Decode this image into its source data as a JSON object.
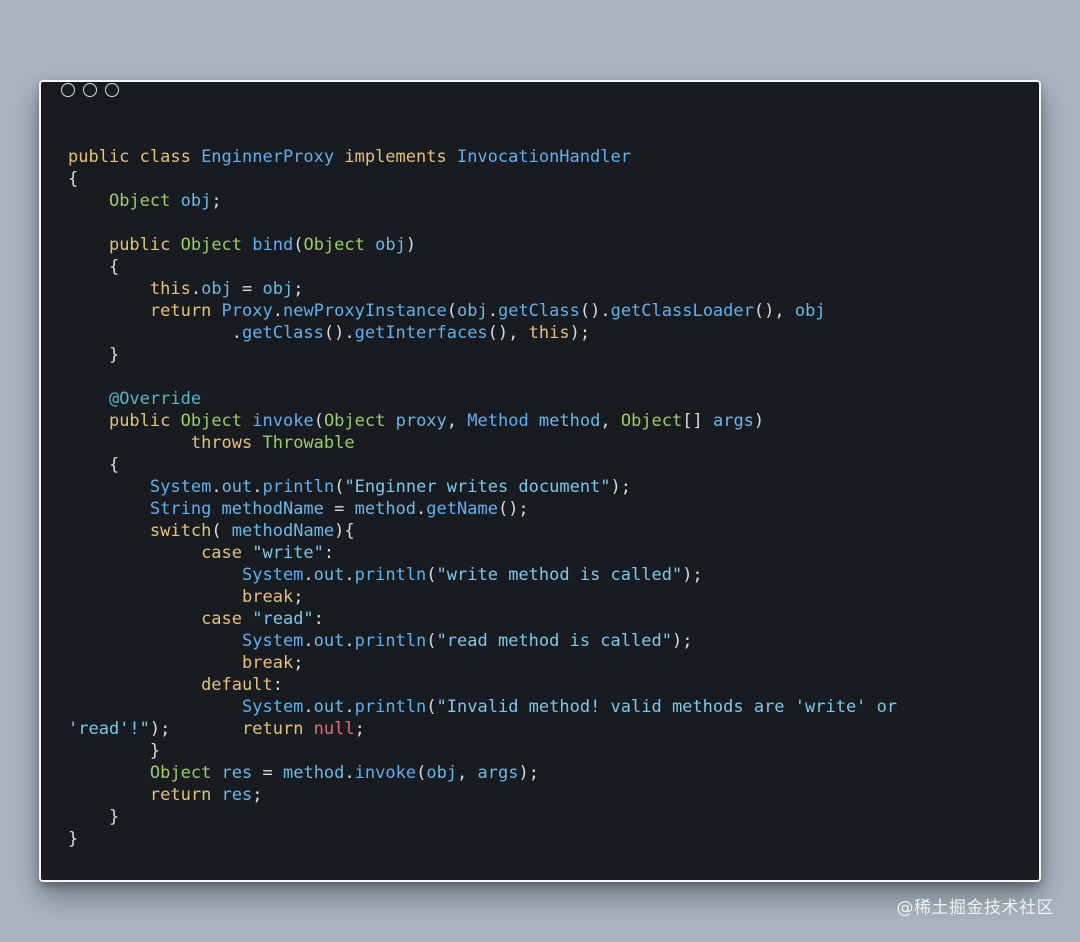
{
  "window": {
    "controls": [
      "window-dot",
      "window-dot",
      "window-dot"
    ]
  },
  "code": {
    "language": "java",
    "lines": [
      [
        [
          "kw",
          "public class "
        ],
        [
          "fn",
          "EnginnerProxy "
        ],
        [
          "kw",
          "implements "
        ],
        [
          "fn",
          "InvocationHandler"
        ]
      ],
      [
        [
          "pu",
          "{"
        ]
      ],
      [
        [
          "pu",
          "    "
        ],
        [
          "ty",
          "Object "
        ],
        [
          "id",
          "obj"
        ],
        [
          "pu",
          ";"
        ]
      ],
      [],
      [
        [
          "pu",
          "    "
        ],
        [
          "kw",
          "public "
        ],
        [
          "ty",
          "Object "
        ],
        [
          "fn",
          "bind"
        ],
        [
          "pu",
          "("
        ],
        [
          "ty",
          "Object "
        ],
        [
          "id",
          "obj"
        ],
        [
          "pu",
          ")"
        ]
      ],
      [
        [
          "pu",
          "    {"
        ]
      ],
      [
        [
          "pu",
          "        "
        ],
        [
          "kw",
          "this"
        ],
        [
          "pu",
          "."
        ],
        [
          "id",
          "obj"
        ],
        [
          "pu",
          " = "
        ],
        [
          "id",
          "obj"
        ],
        [
          "pu",
          ";"
        ]
      ],
      [
        [
          "pu",
          "        "
        ],
        [
          "kw",
          "return "
        ],
        [
          "fn",
          "Proxy"
        ],
        [
          "pu",
          "."
        ],
        [
          "fn",
          "newProxyInstance"
        ],
        [
          "pu",
          "("
        ],
        [
          "id",
          "obj"
        ],
        [
          "pu",
          "."
        ],
        [
          "fn",
          "getClass"
        ],
        [
          "pu",
          "()."
        ],
        [
          "fn",
          "getClassLoader"
        ],
        [
          "pu",
          "(), "
        ],
        [
          "id",
          "obj"
        ]
      ],
      [
        [
          "pu",
          "                ."
        ],
        [
          "fn",
          "getClass"
        ],
        [
          "pu",
          "()."
        ],
        [
          "fn",
          "getInterfaces"
        ],
        [
          "pu",
          "(), "
        ],
        [
          "kw",
          "this"
        ],
        [
          "pu",
          ");"
        ]
      ],
      [
        [
          "pu",
          "    }"
        ]
      ],
      [],
      [
        [
          "pu",
          "    "
        ],
        [
          "an",
          "@Override"
        ]
      ],
      [
        [
          "pu",
          "    "
        ],
        [
          "kw",
          "public "
        ],
        [
          "ty",
          "Object "
        ],
        [
          "fn",
          "invoke"
        ],
        [
          "pu",
          "("
        ],
        [
          "ty",
          "Object "
        ],
        [
          "id",
          "proxy"
        ],
        [
          "pu",
          ", "
        ],
        [
          "fn",
          "Method "
        ],
        [
          "id",
          "method"
        ],
        [
          "pu",
          ", "
        ],
        [
          "ty",
          "Object"
        ],
        [
          "pu",
          "[] "
        ],
        [
          "id",
          "args"
        ],
        [
          "pu",
          ")"
        ]
      ],
      [
        [
          "pu",
          "            "
        ],
        [
          "kw",
          "throws "
        ],
        [
          "ty",
          "Throwable"
        ]
      ],
      [
        [
          "pu",
          "    {"
        ]
      ],
      [
        [
          "pu",
          "        "
        ],
        [
          "fn",
          "System"
        ],
        [
          "pu",
          "."
        ],
        [
          "id",
          "out"
        ],
        [
          "pu",
          "."
        ],
        [
          "fn",
          "println"
        ],
        [
          "pu",
          "("
        ],
        [
          "st",
          "\"Enginner writes document\""
        ],
        [
          "pu",
          ");"
        ]
      ],
      [
        [
          "pu",
          "        "
        ],
        [
          "fn",
          "String "
        ],
        [
          "id",
          "methodName"
        ],
        [
          "pu",
          " = "
        ],
        [
          "id",
          "method"
        ],
        [
          "pu",
          "."
        ],
        [
          "fn",
          "getName"
        ],
        [
          "pu",
          "();"
        ]
      ],
      [
        [
          "pu",
          "        "
        ],
        [
          "kw",
          "switch"
        ],
        [
          "pu",
          "( "
        ],
        [
          "id",
          "methodName"
        ],
        [
          "pu",
          "){"
        ]
      ],
      [
        [
          "pu",
          "             "
        ],
        [
          "kw",
          "case "
        ],
        [
          "st",
          "\"write\""
        ],
        [
          "pu",
          ":"
        ]
      ],
      [
        [
          "pu",
          "                 "
        ],
        [
          "fn",
          "System"
        ],
        [
          "pu",
          "."
        ],
        [
          "id",
          "out"
        ],
        [
          "pu",
          "."
        ],
        [
          "fn",
          "println"
        ],
        [
          "pu",
          "("
        ],
        [
          "st",
          "\"write method is called\""
        ],
        [
          "pu",
          ");"
        ]
      ],
      [
        [
          "pu",
          "                 "
        ],
        [
          "kw",
          "break"
        ],
        [
          "pu",
          ";"
        ]
      ],
      [
        [
          "pu",
          "             "
        ],
        [
          "kw",
          "case "
        ],
        [
          "st",
          "\"read\""
        ],
        [
          "pu",
          ":"
        ]
      ],
      [
        [
          "pu",
          "                 "
        ],
        [
          "fn",
          "System"
        ],
        [
          "pu",
          "."
        ],
        [
          "id",
          "out"
        ],
        [
          "pu",
          "."
        ],
        [
          "fn",
          "println"
        ],
        [
          "pu",
          "("
        ],
        [
          "st",
          "\"read method is called\""
        ],
        [
          "pu",
          ");"
        ]
      ],
      [
        [
          "pu",
          "                 "
        ],
        [
          "kw",
          "break"
        ],
        [
          "pu",
          ";"
        ]
      ],
      [
        [
          "pu",
          "             "
        ],
        [
          "kw",
          "default"
        ],
        [
          "pu",
          ":"
        ]
      ],
      [
        [
          "pu",
          "                 "
        ],
        [
          "fn",
          "System"
        ],
        [
          "pu",
          "."
        ],
        [
          "id",
          "out"
        ],
        [
          "pu",
          "."
        ],
        [
          "fn",
          "println"
        ],
        [
          "pu",
          "("
        ],
        [
          "st",
          "\"Invalid method! valid methods are 'write' or"
        ]
      ],
      [
        [
          "st",
          "'read'!\""
        ],
        [
          "pu",
          ");       "
        ],
        [
          "kw",
          "return "
        ],
        [
          "nl",
          "null"
        ],
        [
          "pu",
          ";"
        ]
      ],
      [
        [
          "pu",
          "        }"
        ]
      ],
      [
        [
          "pu",
          "        "
        ],
        [
          "ty",
          "Object "
        ],
        [
          "id",
          "res"
        ],
        [
          "pu",
          " = "
        ],
        [
          "id",
          "method"
        ],
        [
          "pu",
          "."
        ],
        [
          "fn",
          "invoke"
        ],
        [
          "pu",
          "("
        ],
        [
          "id",
          "obj"
        ],
        [
          "pu",
          ", "
        ],
        [
          "id",
          "args"
        ],
        [
          "pu",
          ");"
        ]
      ],
      [
        [
          "pu",
          "        "
        ],
        [
          "kw",
          "return "
        ],
        [
          "id",
          "res"
        ],
        [
          "pu",
          ";"
        ]
      ],
      [
        [
          "pu",
          "    }"
        ]
      ],
      [
        [
          "pu",
          "}"
        ]
      ]
    ]
  },
  "watermark": {
    "text": "@稀土掘金技术社区"
  },
  "colors": {
    "background": "#aab4c0",
    "editor_bg": "#181c21",
    "keyword": "#e5c07b",
    "type": "#9ccb6b",
    "function": "#61afef",
    "identifier": "#6cb8e6",
    "string": "#7fc7e8",
    "null": "#e06c75",
    "annotation": "#56b6c2",
    "punctuation": "#d6dde4"
  }
}
